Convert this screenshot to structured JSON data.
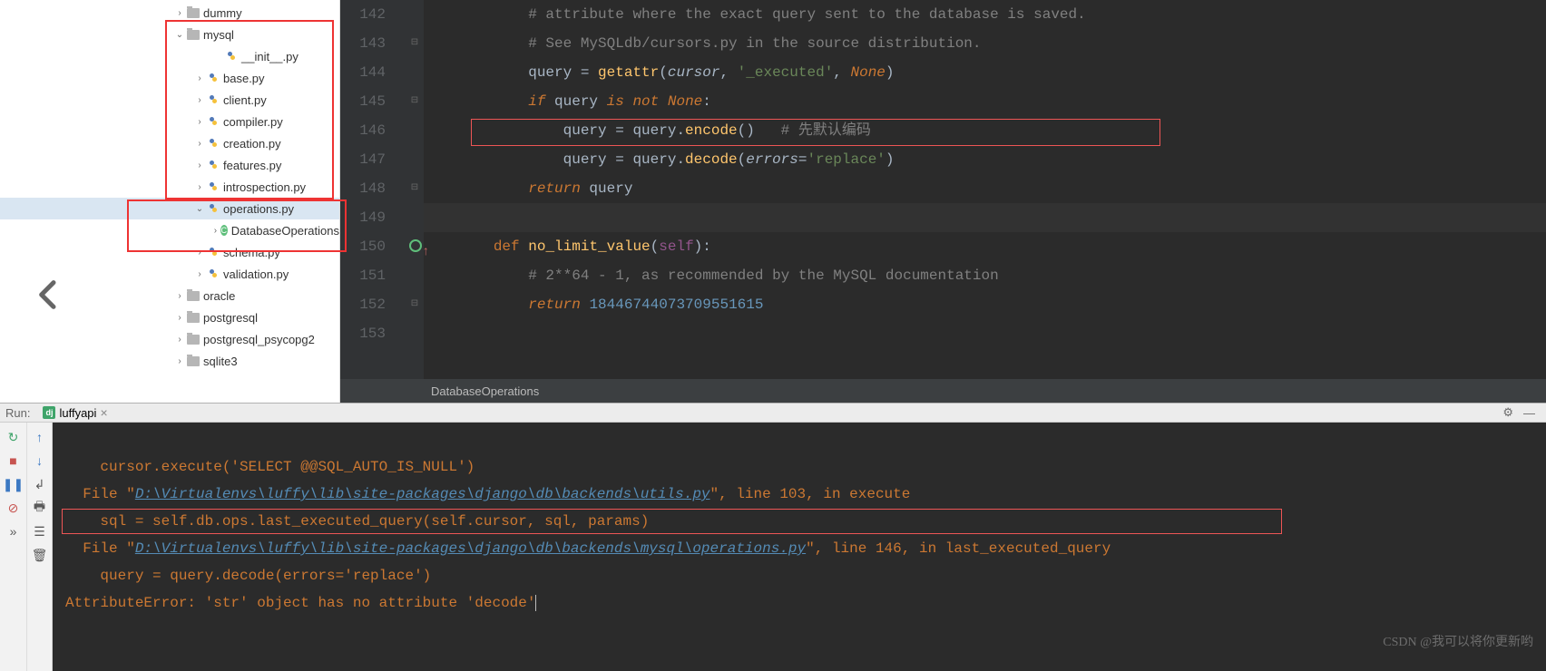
{
  "tree": {
    "rows": [
      {
        "indent": 190,
        "chev": "›",
        "icon": "folder",
        "label": "dummy"
      },
      {
        "indent": 190,
        "chev": "⌄",
        "icon": "folder",
        "label": "mysql"
      },
      {
        "indent": 232,
        "chev": "",
        "icon": "py",
        "label": "__init__.py"
      },
      {
        "indent": 212,
        "chev": "›",
        "icon": "py",
        "label": "base.py"
      },
      {
        "indent": 212,
        "chev": "›",
        "icon": "py",
        "label": "client.py"
      },
      {
        "indent": 212,
        "chev": "›",
        "icon": "py",
        "label": "compiler.py"
      },
      {
        "indent": 212,
        "chev": "›",
        "icon": "py",
        "label": "creation.py"
      },
      {
        "indent": 212,
        "chev": "›",
        "icon": "py",
        "label": "features.py"
      },
      {
        "indent": 212,
        "chev": "›",
        "icon": "py",
        "label": "introspection.py"
      },
      {
        "indent": 212,
        "chev": "⌄",
        "icon": "py",
        "label": "operations.py",
        "selected": true
      },
      {
        "indent": 232,
        "chev": "›",
        "icon": "class",
        "label": "DatabaseOperations"
      },
      {
        "indent": 212,
        "chev": "›",
        "icon": "py",
        "label": "schema.py"
      },
      {
        "indent": 212,
        "chev": "›",
        "icon": "py",
        "label": "validation.py"
      },
      {
        "indent": 190,
        "chev": "›",
        "icon": "folder",
        "label": "oracle"
      },
      {
        "indent": 190,
        "chev": "›",
        "icon": "folder",
        "label": "postgresql"
      },
      {
        "indent": 190,
        "chev": "›",
        "icon": "folder",
        "label": "postgresql_psycopg2"
      },
      {
        "indent": 190,
        "chev": "›",
        "icon": "folder",
        "label": "sqlite3"
      }
    ]
  },
  "gutter": [
    "142",
    "143",
    "144",
    "145",
    "146",
    "147",
    "148",
    "149",
    "150",
    "151",
    "152",
    "153"
  ],
  "code": {
    "l142": "# attribute where the exact query sent to the database is saved.",
    "l143": "# See MySQLdb/cursors.py in the source distribution.",
    "l144_a": "query = ",
    "l144_b": "getattr",
    "l144_c": "(",
    "l144_d": "cursor",
    "l144_e": ", ",
    "l144_f": "'_executed'",
    "l144_g": ", ",
    "l144_h": "None",
    "l144_i": ")",
    "l145_a": "if",
    "l145_b": " query ",
    "l145_c": "is not",
    "l145_d": " ",
    "l145_e": "None",
    "l145_f": ":",
    "l146_a": "query = query.",
    "l146_b": "encode",
    "l146_c": "()   ",
    "l146_d": "# 先默认编码",
    "l147_a": "query = query.",
    "l147_b": "decode",
    "l147_c": "(",
    "l147_d": "errors",
    "l147_e": "=",
    "l147_f": "'replace'",
    "l147_g": ")",
    "l148_a": "return",
    "l148_b": " query",
    "l150_a": "def",
    "l150_b": " ",
    "l150_c": "no_limit_value",
    "l150_d": "(",
    "l150_e": "self",
    "l150_f": "):",
    "l151": "# 2**64 - 1, as recommended by the MySQL documentation",
    "l152_a": "return",
    "l152_b": " ",
    "l152_c": "18446744073709551615"
  },
  "breadcrumb": "DatabaseOperations",
  "run": {
    "label": "Run:",
    "tab": "luffyapi",
    "lines": {
      "a": "    cursor.execute('SELECT @@SQL_AUTO_IS_NULL')",
      "b1": "  File \"",
      "b2": "D:\\Virtualenvs\\luffy\\lib\\site-packages\\django\\db\\backends\\utils.py",
      "b3": "\", line 103, in execute",
      "c": "    sql = self.db.ops.last_executed_query(self.cursor, sql, params)",
      "d1": "  File \"",
      "d2": "D:\\Virtualenvs\\luffy\\lib\\site-packages\\django\\db\\backends\\mysql\\operations.py",
      "d3": "\", line 146, in last_executed_query",
      "e": "    query = query.decode(errors='replace')",
      "f": "AttributeError: 'str' object has no attribute 'decode'"
    }
  },
  "watermark": "CSDN @我可以将你更新哟"
}
